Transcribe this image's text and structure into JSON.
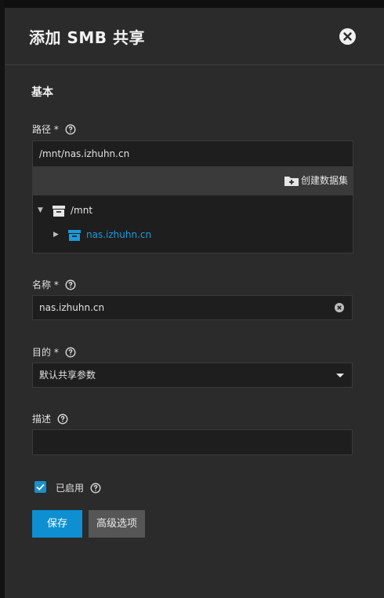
{
  "dialog": {
    "title": "添加 SMB 共享"
  },
  "section": {
    "title": "基本"
  },
  "path": {
    "label": "路径 *",
    "value": "/mnt/nas.izhuhn.cn",
    "create_dataset_label": "创建数据集",
    "tree": [
      {
        "name": "/mnt",
        "expanded": true,
        "color": "#e6e6e6"
      },
      {
        "name": "nas.izhuhn.cn",
        "expanded": false,
        "color": "#1a9bdb"
      }
    ]
  },
  "name": {
    "label": "名称 *",
    "value": "nas.izhuhn.cn"
  },
  "purpose": {
    "label": "目的 *",
    "value": "默认共享参数"
  },
  "description": {
    "label": "描述",
    "value": ""
  },
  "enabled": {
    "label": "已启用",
    "checked": true
  },
  "buttons": {
    "save": "保存",
    "advanced": "高级选项"
  },
  "colors": {
    "accent": "#0d8fd1",
    "panel": "#2b2b2b",
    "field": "#1e1e1e"
  }
}
